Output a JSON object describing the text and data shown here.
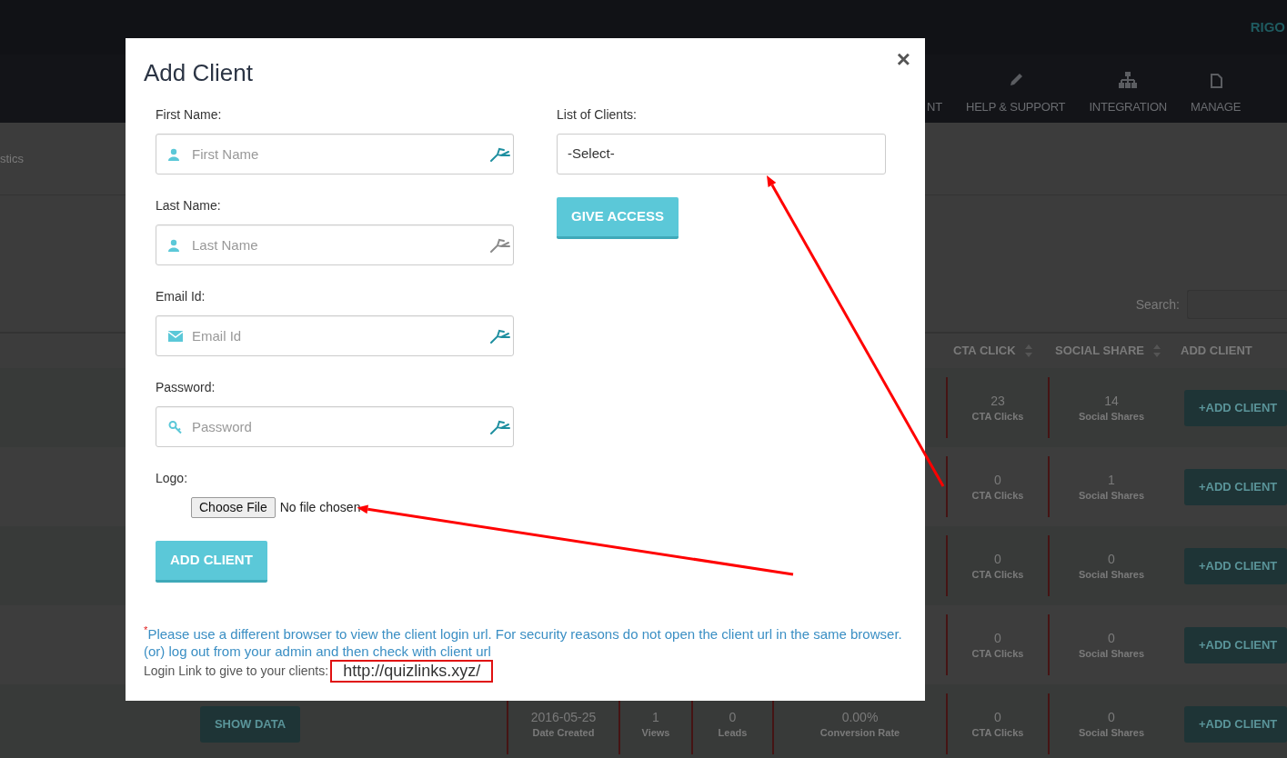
{
  "top_bar": {
    "user": "RIGO"
  },
  "nav": [
    {
      "label": "NT"
    },
    {
      "label": "HELP & SUPPORT"
    },
    {
      "label": "INTEGRATION"
    },
    {
      "label": "MANAGE"
    }
  ],
  "breadcrumb": "stics",
  "search": {
    "label": "Search:"
  },
  "table": {
    "columns": [
      {
        "label": "CTA CLICK",
        "sortable": true
      },
      {
        "label": "SOCIAL SHARE",
        "sortable": true
      },
      {
        "label": "ADD CLIENT",
        "sortable": false
      }
    ],
    "rows": [
      {
        "stats": [
          {
            "value": "23",
            "label": "CTA Clicks"
          },
          {
            "value": "14",
            "label": "Social Shares"
          }
        ],
        "action": "+ADD CLIENT"
      },
      {
        "stats": [
          {
            "value": "0",
            "label": "CTA Clicks"
          },
          {
            "value": "1",
            "label": "Social Shares"
          }
        ],
        "action": "+ADD CLIENT"
      },
      {
        "stats": [
          {
            "value": "0",
            "label": "CTA Clicks"
          },
          {
            "value": "0",
            "label": "Social Shares"
          }
        ],
        "action": "+ADD CLIENT"
      },
      {
        "stats": [
          {
            "value": "0",
            "label": "CTA Clicks"
          },
          {
            "value": "0",
            "label": "Social Shares"
          }
        ],
        "action": "+ADD CLIENT"
      },
      {
        "show_data": "SHOW DATA",
        "stats": [
          {
            "value": "2016-05-25",
            "label": "Date Created"
          },
          {
            "value": "1",
            "label": "Views"
          },
          {
            "value": "0",
            "label": "Leads"
          },
          {
            "value": "0.00%",
            "label": "Conversion Rate"
          },
          {
            "value": "0",
            "label": "CTA Clicks"
          },
          {
            "value": "0",
            "label": "Social Shares"
          }
        ],
        "action": "+ADD CLIENT"
      }
    ]
  },
  "modal": {
    "title": "Add Client",
    "close": "×",
    "fields": [
      {
        "label": "First Name:",
        "placeholder": "First Name",
        "autofill_active": true
      },
      {
        "label": "Last Name:",
        "placeholder": "Last Name",
        "autofill_active": false
      },
      {
        "label": "Email Id:",
        "placeholder": "Email Id",
        "autofill_active": true
      },
      {
        "label": "Password:",
        "placeholder": "Password",
        "autofill_active": true
      }
    ],
    "logo": {
      "label": "Logo:",
      "button": "Choose File",
      "status": "No file chosen",
      "annotated": true
    },
    "submit": "ADD CLIENT",
    "clients": {
      "label": "List of Clients:",
      "value": "-Select-",
      "annotated": true
    },
    "give_access": "GIVE ACCESS",
    "notes": [
      "$^{*}$Please use a different browser to view the client login url. For security reasons do not open the client url in the same browser.",
      "(or) log out from your admin and then check with client url"
    ],
    "login": {
      "label": "Login Link to give to your clients:",
      "url": "http://quizlinks.xyz/",
      "highlighted": true
    }
  }
}
